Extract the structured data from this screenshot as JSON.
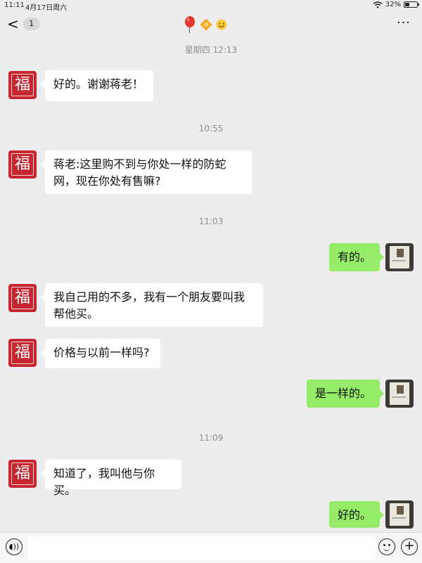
{
  "status_bar": {
    "time": "11:11",
    "date": "4月17日周六",
    "battery": "32%",
    "battery_level": 0.32
  },
  "header": {
    "back_label": "<",
    "unread_count": "1",
    "title_icons": [
      "balloon-icon",
      "diamond-icon",
      "smiley-icon"
    ],
    "more_label": "···"
  },
  "avatars": {
    "contact_glyph": "福"
  },
  "timestamps": [
    "星期四 12:13",
    "10:55",
    "11:03",
    "11:09"
  ],
  "messages": [
    {
      "side": "left",
      "text": "好的。谢谢蒋老！"
    },
    {
      "side": "left",
      "text": "蒋老:这里购不到与你处一样的防蛇网，现在你处有售嘛?"
    },
    {
      "side": "right",
      "text": "有的。"
    },
    {
      "side": "left",
      "text": "我自己用的不多，我有一个朋友要叫我帮他买。"
    },
    {
      "side": "left",
      "text": "价格与以前一样吗?"
    },
    {
      "side": "right",
      "text": "是一样的。"
    },
    {
      "side": "left",
      "text": "知道了，我叫他与你买。"
    },
    {
      "side": "right",
      "text": "好的。"
    }
  ],
  "colors": {
    "background": "#ededed",
    "bubble_sent": "#95ec69",
    "bubble_received": "#ffffff",
    "contact_avatar": "#c5262f"
  }
}
